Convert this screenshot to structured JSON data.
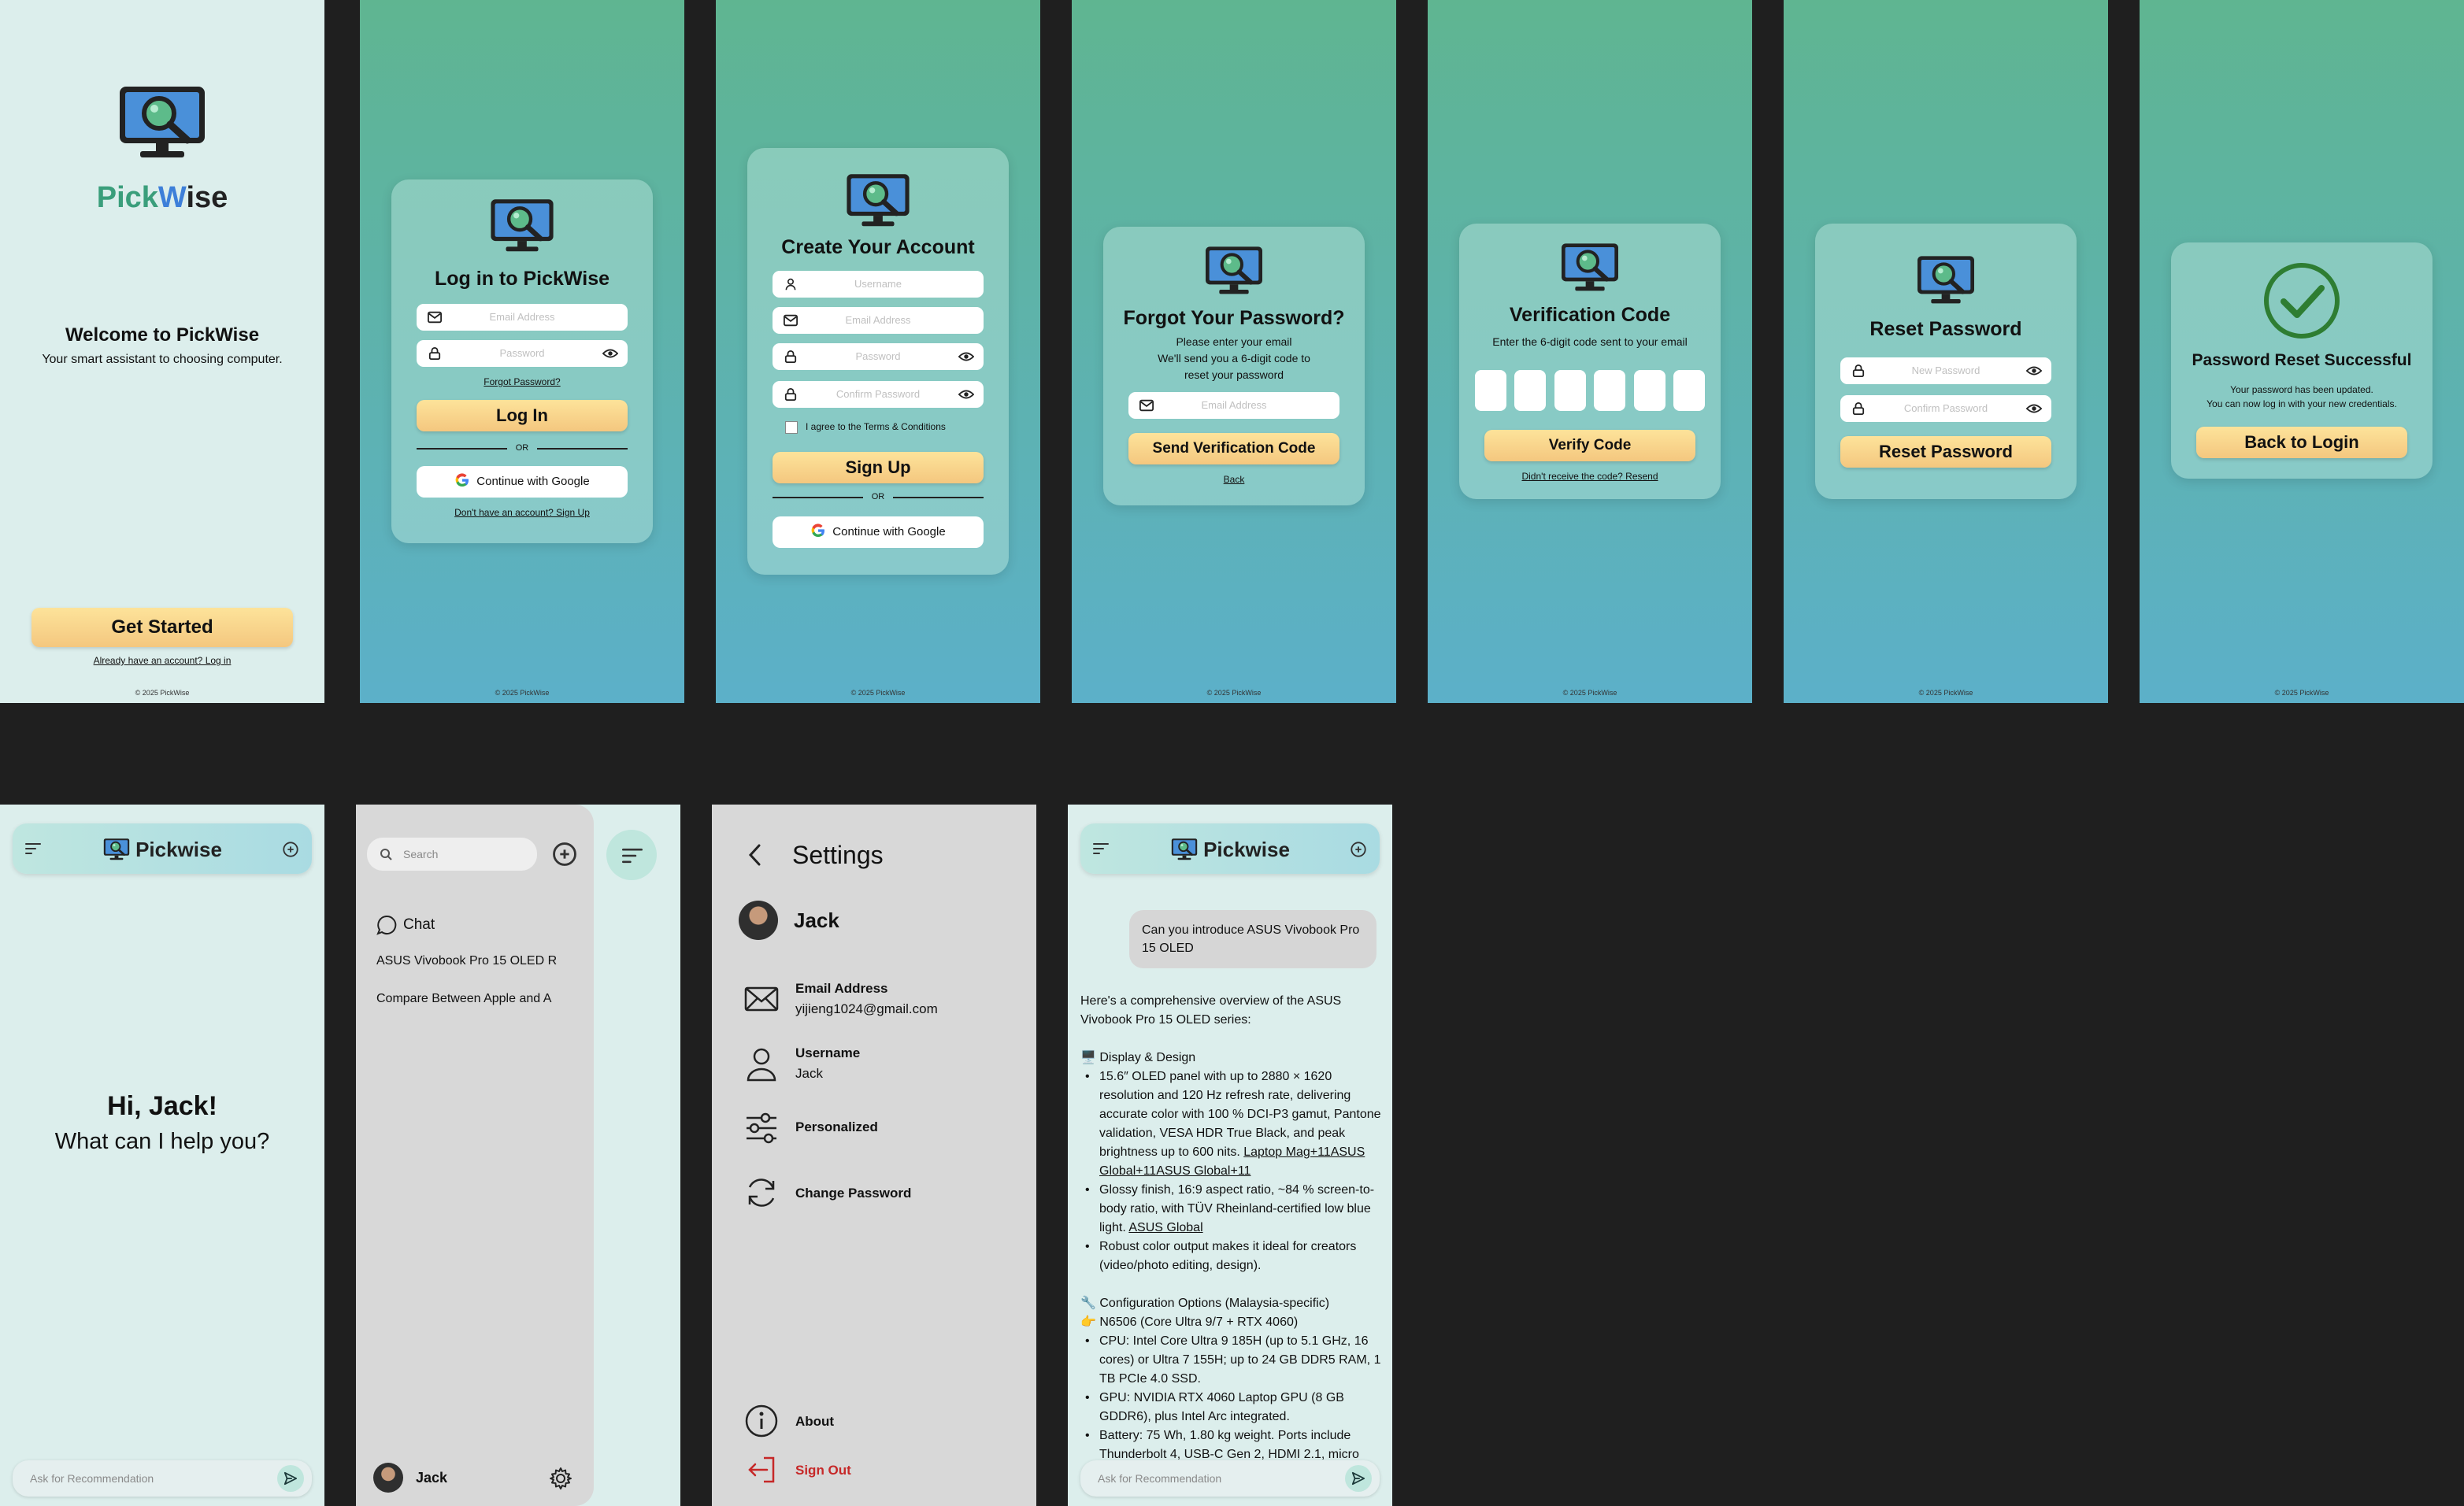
{
  "welcome": {
    "brand_a": "Pick",
    "brand_b": "W",
    "brand_c": "ise",
    "title": "Welcome to PickWise",
    "subtitle": "Your smart assistant to choosing computer.",
    "cta": "Get Started",
    "login_link": "Already have an account? Log in",
    "footer": "© 2025 PickWise"
  },
  "login": {
    "title": "Log in to PickWise",
    "email_placeholder": "Email Address",
    "password_placeholder": "Password",
    "forgot": "Forgot Password?",
    "button": "Log In",
    "or": "OR",
    "google": "Continue with Google",
    "signup_link": "Don't have an account? Sign Up",
    "footer": "© 2025 PickWise"
  },
  "signup": {
    "title": "Create Your Account",
    "username_placeholder": "Username",
    "email_placeholder": "Email Address",
    "password_placeholder": "Password",
    "confirm_placeholder": "Confirm Password",
    "terms": "I agree to the Terms & Conditions",
    "button": "Sign Up",
    "or": "OR",
    "google": "Continue with Google",
    "footer": "© 2025 PickWise"
  },
  "forgot": {
    "title": "Forgot Your Password?",
    "line1": "Please enter your email",
    "line2": "We'll send you a 6-digit code to",
    "line3": "reset your password",
    "email_placeholder": "Email Address",
    "button": "Send Verification Code",
    "back": "Back",
    "footer": "© 2025 PickWise"
  },
  "verify": {
    "title": "Verification Code",
    "subtitle": "Enter the 6-digit code sent to your email",
    "button": "Verify Code",
    "resend": "Didn't receive the code? Resend",
    "footer": "© 2025 PickWise"
  },
  "reset": {
    "title": "Reset Password",
    "new_placeholder": "New Password",
    "confirm_placeholder": "Confirm Password",
    "button": "Reset Password",
    "footer": "© 2025 PickWise"
  },
  "success": {
    "title": "Password Reset Successful",
    "line1": "Your password has been updated.",
    "line2": "You can now log in with your new credentials.",
    "button": "Back to Login",
    "footer": "© 2025 PickWise"
  },
  "home": {
    "brand": "Pickwise",
    "greeting": "Hi, Jack!",
    "prompt": "What can I help you?",
    "ask_placeholder": "Ask for Recommendation"
  },
  "sidebar": {
    "search_placeholder": "Search",
    "chat_label": "Chat",
    "items": [
      "ASUS Vivobook Pro 15 OLED R",
      "Compare Between Apple and A"
    ],
    "user": "Jack"
  },
  "settings": {
    "title": "Settings",
    "user": "Jack",
    "email_label": "Email Address",
    "email_value": "yijieng1024@gmail.com",
    "username_label": "Username",
    "username_value": "Jack",
    "personalized": "Personalized",
    "change_password": "Change Password",
    "about": "About",
    "sign_out": "Sign Out",
    "sign_out_color": "#c62828"
  },
  "chat": {
    "brand": "Pickwise",
    "user_message": "Can you introduce ASUS Vivobook Pro 15 OLED",
    "intro": "Here's a comprehensive overview of the ASUS Vivobook Pro 15 OLED series:",
    "section1_title": "🖥️ Display & Design",
    "section1_bullets": [
      "15.6″ OLED panel with up to 2880 × 1620 resolution and 120 Hz refresh rate, delivering accurate color with 100 % DCI-P3 gamut, Pantone validation, VESA HDR True Black, and peak brightness up to 600 nits.",
      "Glossy finish, 16:9 aspect ratio, ~84 % screen-to-body ratio, with TÜV Rheinland-certified low blue light.",
      "Robust color output makes it ideal for creators (video/photo editing, design)."
    ],
    "link1": "Laptop Mag+11ASUS Global+11ASUS Global+11",
    "link2": "ASUS Global",
    "section2_title": "🔧 Configuration Options (Malaysia-specific)",
    "section2_sub": "👉 N6506 (Core Ultra 9/7 + RTX 4060)",
    "section2_bullets": [
      "CPU: Intel Core Ultra 9 185H (up to 5.1 GHz, 16 cores) or Ultra 7 155H; up to 24 GB DDR5 RAM, 1 TB PCIe 4.0 SSD.",
      "GPU: NVIDIA RTX 4060 Laptop GPU (8 GB GDDR6), plus Intel Arc integrated.",
      "Battery: 75 Wh, 1.80 kg weight. Ports include Thunderbolt 4, USB-C Gen 2, HDMI 2.1, micro"
    ],
    "ask_placeholder": "Ask for Recommendation"
  },
  "colors": {
    "brand_green": "#3a9e7b",
    "brand_blue": "#3d7fd9",
    "button_yellow": "#f6cd82",
    "sign_out_red": "#c62828",
    "check_green": "#2e7d32"
  }
}
